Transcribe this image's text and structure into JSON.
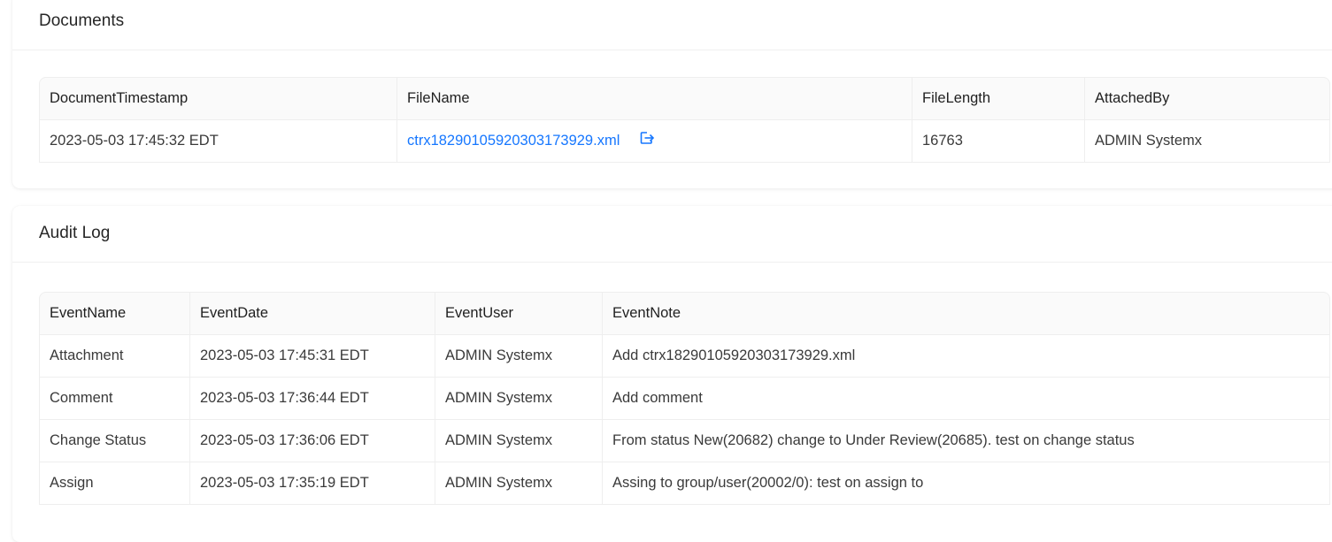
{
  "documents": {
    "title": "Documents",
    "columns": [
      "DocumentTimestamp",
      "FileName",
      "FileLength",
      "AttachedBy"
    ],
    "rows": [
      {
        "timestamp": "2023-05-03 17:45:32 EDT",
        "file_name": "ctrx18290105920303173929.xml",
        "file_length": "16763",
        "attached_by": "ADMIN Systemx"
      }
    ],
    "open_icon": "external-link-icon",
    "link_color": "#1677ff"
  },
  "audit_log": {
    "title": "Audit Log",
    "columns": [
      "EventName",
      "EventDate",
      "EventUser",
      "EventNote"
    ],
    "rows": [
      {
        "event_name": "Attachment",
        "event_date": "2023-05-03 17:45:31 EDT",
        "event_user": "ADMIN Systemx",
        "event_note": "Add ctrx18290105920303173929.xml"
      },
      {
        "event_name": "Comment",
        "event_date": "2023-05-03 17:36:44 EDT",
        "event_user": "ADMIN Systemx",
        "event_note": "Add comment"
      },
      {
        "event_name": "Change Status",
        "event_date": "2023-05-03 17:36:06 EDT",
        "event_user": "ADMIN Systemx",
        "event_note": "From status New(20682) change to Under Review(20685). test on change status"
      },
      {
        "event_name": "Assign",
        "event_date": "2023-05-03 17:35:19 EDT",
        "event_user": "ADMIN Systemx",
        "event_note": "Assing to group/user(20002/0): test on assign to"
      }
    ]
  }
}
